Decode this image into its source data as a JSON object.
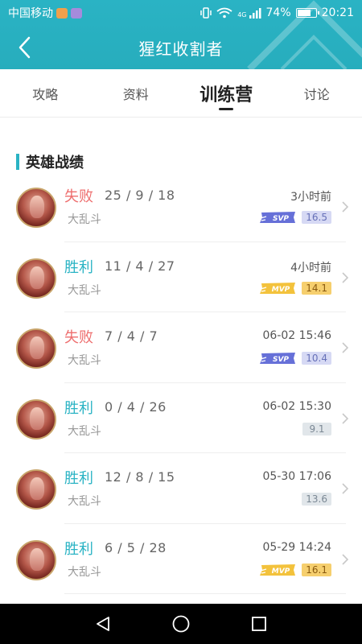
{
  "status_bar": {
    "carrier": "中国移动",
    "network": "4G",
    "battery": "74%",
    "battery_level": 0.74,
    "time": "20:21"
  },
  "header": {
    "title": "猩红收割者"
  },
  "tabs": [
    {
      "label": "攻略",
      "active": false
    },
    {
      "label": "资料",
      "active": false
    },
    {
      "label": "训练营",
      "active": true
    },
    {
      "label": "讨论",
      "active": false
    }
  ],
  "section": {
    "title": "英雄战绩"
  },
  "records": [
    {
      "result": "失败",
      "outcome": "lose",
      "kda": "25 / 9 / 18",
      "mode": "大乱斗",
      "time": "3小时前",
      "medal": "SVP",
      "score": "16.5"
    },
    {
      "result": "胜利",
      "outcome": "win",
      "kda": "11 / 4 / 27",
      "mode": "大乱斗",
      "time": "4小时前",
      "medal": "MVP",
      "score": "14.1"
    },
    {
      "result": "失败",
      "outcome": "lose",
      "kda": "7 / 4 / 7",
      "mode": "大乱斗",
      "time": "06-02 15:46",
      "medal": "SVP",
      "score": "10.4"
    },
    {
      "result": "胜利",
      "outcome": "win",
      "kda": "0 / 4 / 26",
      "mode": "大乱斗",
      "time": "06-02 15:30",
      "medal": "",
      "score": "9.1"
    },
    {
      "result": "胜利",
      "outcome": "win",
      "kda": "12 / 8 / 15",
      "mode": "大乱斗",
      "time": "05-30 17:06",
      "medal": "",
      "score": "13.6"
    },
    {
      "result": "胜利",
      "outcome": "win",
      "kda": "6 / 5 / 28",
      "mode": "大乱斗",
      "time": "05-29 14:24",
      "medal": "MVP",
      "score": "16.1"
    }
  ],
  "colors": {
    "accent": "#2ab3c4",
    "lose": "#ee6e6e",
    "win": "#2ab3c4",
    "svp": "#6670d8",
    "mvp": "#f3c23c"
  },
  "icons": {
    "back": "chevron-left-icon",
    "row_arrow": "chevron-right-icon",
    "nav": [
      "back-triangle-icon",
      "home-circle-icon",
      "recents-square-icon"
    ]
  }
}
